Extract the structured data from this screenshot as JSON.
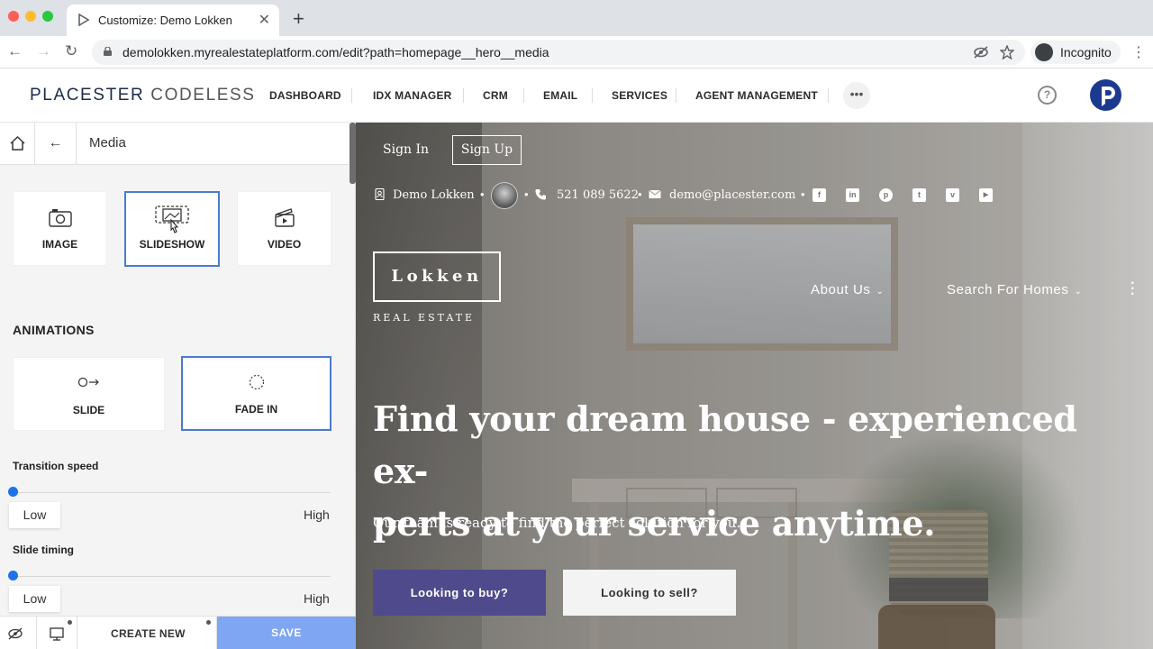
{
  "browser": {
    "tab_title": "Customize: Demo Lokken",
    "tab_close": "✕",
    "new_tab": "+",
    "url": "demolokken.myrealestateplatform.com/edit?path=homepage__hero__media",
    "profile_label": "Incognito",
    "nav": {
      "back": "←",
      "forward": "→",
      "reload": "↻"
    },
    "icons": [
      "lock-icon",
      "eye-off-icon",
      "star-icon",
      "incognito-icon",
      "kebab-icon"
    ]
  },
  "app_header": {
    "brand_primary": "PLACESTER",
    "brand_secondary": "CODELESS",
    "nav_items": [
      "DASHBOARD",
      "IDX MANAGER",
      "CRM",
      "EMAIL",
      "SERVICES",
      "AGENT MANAGEMENT"
    ],
    "more": "•••",
    "help": "?",
    "avatar_color": "#1b3a8f"
  },
  "panel": {
    "title": "Media",
    "back": "←",
    "media_types": [
      {
        "label": "IMAGE",
        "icon": "camera-icon",
        "selected": false
      },
      {
        "label": "SLIDESHOW",
        "icon": "slideshow-icon",
        "selected": true
      },
      {
        "label": "VIDEO",
        "icon": "video-icon",
        "selected": false
      }
    ],
    "animations_title": "ANIMATIONS",
    "animations": [
      {
        "label": "SLIDE",
        "icon": "slide-arrow-icon",
        "selected": false
      },
      {
        "label": "FADE IN",
        "icon": "fade-circle-icon",
        "selected": true
      }
    ],
    "transition_speed": {
      "label": "Transition speed",
      "low": "Low",
      "high": "High",
      "value": 0
    },
    "slide_timing": {
      "label": "Slide timing",
      "low": "Low",
      "high": "High",
      "value": 0
    },
    "footer": {
      "create_new": "CREATE NEW",
      "save": "SAVE"
    },
    "accent_color": "#1d72e8",
    "selected_border": "#4a7bd0"
  },
  "site": {
    "sign_in": "Sign In",
    "sign_up": "Sign Up",
    "agent_name": "Demo Lokken",
    "phone": "521 089 5622",
    "email": "demo@placester.com",
    "social": [
      {
        "name": "facebook-icon",
        "glyph": "f"
      },
      {
        "name": "linkedin-icon",
        "glyph": "in"
      },
      {
        "name": "pinterest-icon",
        "glyph": "p"
      },
      {
        "name": "twitter-icon",
        "glyph": "t"
      },
      {
        "name": "vimeo-icon",
        "glyph": "v"
      },
      {
        "name": "youtube-icon",
        "glyph": "▶"
      }
    ],
    "logo_text": "Lokken",
    "logo_sub": "REAL ESTATE",
    "nav": [
      {
        "label": "About Us"
      },
      {
        "label": "Search For Homes"
      }
    ],
    "chevron": "⌄",
    "hero_title_line1": "Find your dream house - experienced ex-",
    "hero_title_line2": "perts at your service anytime.",
    "hero_subtitle": "Our team is ready to find the perfect solution for you.",
    "cta_buy": "Looking to buy?",
    "cta_sell": "Looking to sell?",
    "cta_buy_color": "#4f4a8b"
  }
}
